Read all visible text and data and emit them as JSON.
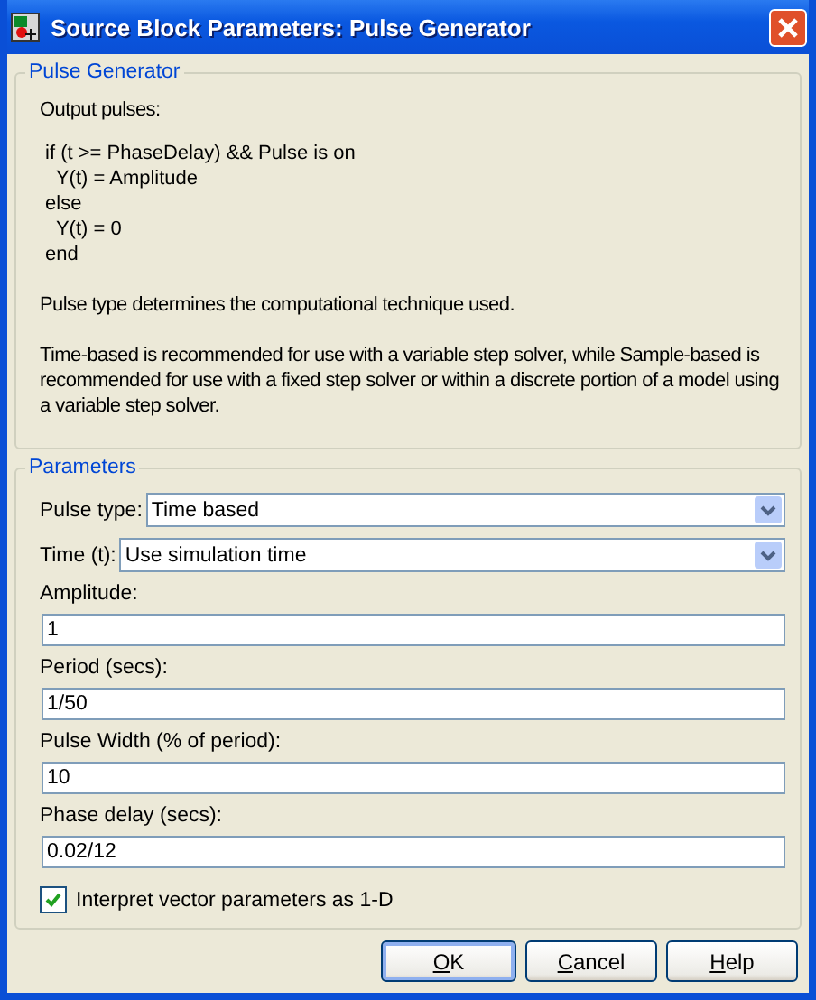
{
  "window": {
    "title": "Source Block Parameters: Pulse Generator"
  },
  "description": {
    "title": "Pulse Generator",
    "blocks": [
      {
        "kind": "text",
        "text": "Output pulses:"
      },
      {
        "kind": "code",
        "lines": [
          " if (t >= PhaseDelay) && Pulse is on",
          "   Y(t) = Amplitude",
          " else",
          "   Y(t) = 0",
          " end"
        ]
      },
      {
        "kind": "text",
        "text": "Pulse type determines the computational technique used."
      },
      {
        "kind": "text",
        "text": "Time-based is recommended for use with a variable step solver, while Sample-based is recommended for use with a fixed step solver or within a discrete portion of a model using a variable step solver."
      }
    ]
  },
  "parameters": {
    "title": "Parameters",
    "fields": [
      {
        "kind": "dropdown",
        "label": "Pulse type:",
        "value": "Time based"
      },
      {
        "kind": "dropdown",
        "label": "Time (t):",
        "value": "Use simulation time"
      },
      {
        "kind": "edit",
        "label": "Amplitude:",
        "value": "1"
      },
      {
        "kind": "edit",
        "label": "Period (secs):",
        "value": "1/50"
      },
      {
        "kind": "edit",
        "label": "Pulse Width (% of period):",
        "value": "10"
      },
      {
        "kind": "edit",
        "label": "Phase delay (secs):",
        "value": "0.02/12"
      },
      {
        "kind": "checkbox",
        "label": "Interpret vector parameters as 1-D",
        "checked": true
      }
    ]
  },
  "buttons": [
    {
      "label": "OK",
      "mnemonic": true,
      "default": true
    },
    {
      "label": "Cancel",
      "mnemonic": true,
      "default": false
    },
    {
      "label": "Help",
      "mnemonic": true,
      "default": false
    }
  ]
}
